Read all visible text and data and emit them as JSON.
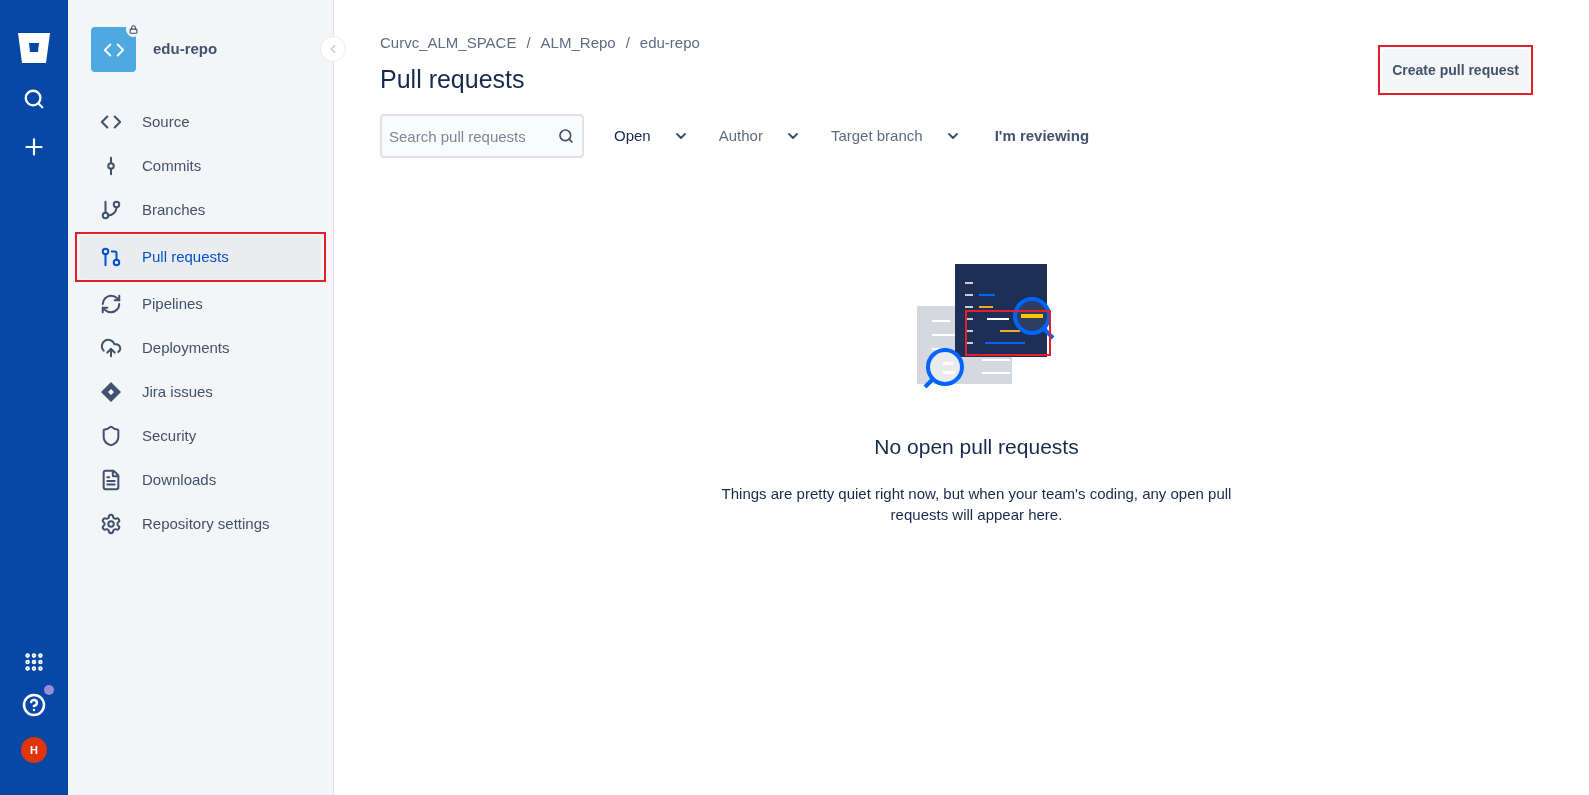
{
  "repo": {
    "name": "edu-repo",
    "private": true
  },
  "sidebar": {
    "items": [
      {
        "label": "Source",
        "selected": false,
        "annotated": false
      },
      {
        "label": "Commits",
        "selected": false,
        "annotated": false
      },
      {
        "label": "Branches",
        "selected": false,
        "annotated": false
      },
      {
        "label": "Pull requests",
        "selected": true,
        "annotated": true
      },
      {
        "label": "Pipelines",
        "selected": false,
        "annotated": false
      },
      {
        "label": "Deployments",
        "selected": false,
        "annotated": false
      },
      {
        "label": "Jira issues",
        "selected": false,
        "annotated": false
      },
      {
        "label": "Security",
        "selected": false,
        "annotated": false
      },
      {
        "label": "Downloads",
        "selected": false,
        "annotated": false
      },
      {
        "label": "Repository settings",
        "selected": false,
        "annotated": false
      }
    ]
  },
  "rail": {
    "avatar": "H",
    "help_notification": true
  },
  "breadcrumbs": {
    "separator": "/",
    "items": [
      "Curvc_ALM_SPACE",
      "ALM_Repo",
      "edu-repo"
    ]
  },
  "title": "Pull requests",
  "create_button": {
    "label": "Create pull request",
    "annotated": true
  },
  "search": {
    "placeholder": "Search pull requests"
  },
  "filters": [
    {
      "kind": "dropdown",
      "label": "Open",
      "active": true
    },
    {
      "kind": "dropdown",
      "label": "Author",
      "active": false
    },
    {
      "kind": "dropdown",
      "label": "Target branch",
      "active": false
    },
    {
      "kind": "toggle",
      "label": "I'm reviewing",
      "active": false
    }
  ],
  "empty_state": {
    "heading": "No open pull requests",
    "message": "Things are pretty quiet right now, but when your team's coding, any open pull requests will appear here.",
    "annotated": true
  }
}
